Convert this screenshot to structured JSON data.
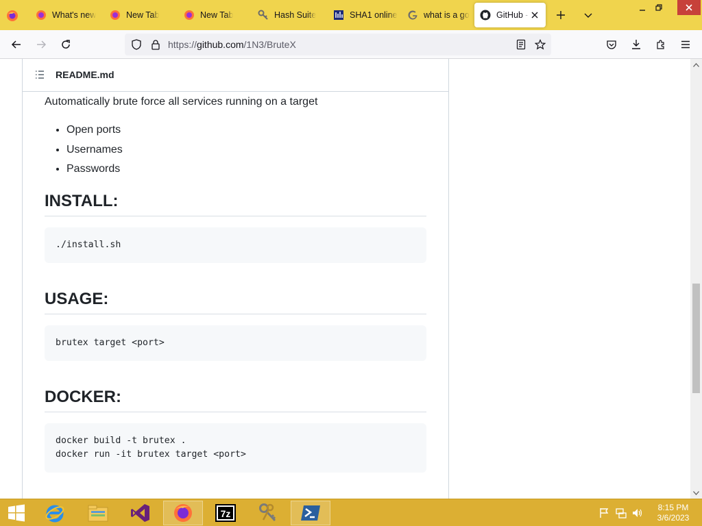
{
  "browser": {
    "tabs": [
      {
        "label": "What's new",
        "icon": "firefox-icon",
        "active": false
      },
      {
        "label": "New Tab",
        "icon": "firefox-icon",
        "active": false
      },
      {
        "label": "New Tab",
        "icon": "firefox-icon",
        "active": false
      },
      {
        "label": "Hash Suite",
        "icon": "hash-suite-keys-icon",
        "active": false
      },
      {
        "label": "SHA1 online",
        "icon": "sha1-site-icon",
        "active": false
      },
      {
        "label": "what is a go",
        "icon": "google-icon",
        "active": false
      },
      {
        "label": "GitHub -",
        "icon": "github-icon",
        "active": true
      }
    ],
    "url": {
      "scheme": "https://",
      "host": "github.com",
      "path": "/1N3/BruteX"
    }
  },
  "readme": {
    "filename": "README.md",
    "intro": "Automatically brute force all services running on a target",
    "features": [
      "Open ports",
      "Usernames",
      "Passwords"
    ],
    "sections": [
      {
        "heading": "INSTALL:",
        "code": "./install.sh"
      },
      {
        "heading": "USAGE:",
        "code": "brutex target <port>"
      },
      {
        "heading": "DOCKER:",
        "code": "docker build -t brutex .\ndocker run -it brutex target <port>"
      }
    ]
  },
  "taskbar": {
    "apps": [
      "internet-explorer-icon",
      "file-explorer-icon",
      "visual-studio-icon",
      "firefox-icon",
      "7zip-icon",
      "hash-suite-keys-icon",
      "powershell-icon"
    ],
    "clock": {
      "time": "8:15 PM",
      "date": "3/6/2023"
    }
  },
  "colors": {
    "tabstrip": "#f0d44d",
    "taskbar": "#dcaf33",
    "codeblock_bg": "#f6f8fa"
  }
}
